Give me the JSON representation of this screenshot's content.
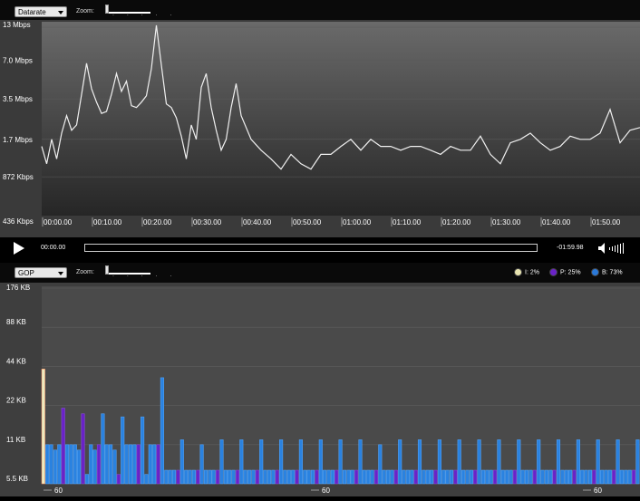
{
  "top": {
    "dropdown_value": "Datarate",
    "zoom_label": "Zoom:",
    "y_ticks": [
      "13 Mbps",
      "7.0 Mbps",
      "3.5 Mbps",
      "1.7 Mbps",
      "872 Kbps",
      "436 Kbps"
    ],
    "x_ticks": [
      "00:00.00",
      "00:10.00",
      "00:20.00",
      "00:30.00",
      "00:40.00",
      "00:50.00",
      "01:00.00",
      "01:10.00",
      "01:20.00",
      "01:30.00",
      "01:40.00",
      "01:50.00"
    ]
  },
  "player": {
    "current_time": "00:00.00",
    "remaining_time": "-01:59.98",
    "play_icon": "play-icon",
    "volume_icon": "speaker-icon"
  },
  "bottom": {
    "dropdown_value": "GOP",
    "zoom_label": "Zoom:",
    "legend": [
      {
        "label": "I: 2%",
        "color": "#e8e4b0"
      },
      {
        "label": "P: 25%",
        "color": "#6a22c8"
      },
      {
        "label": "B: 73%",
        "color": "#2a78d8"
      }
    ],
    "y_ticks": [
      "176 KB",
      "88 KB",
      "44 KB",
      "22 KB",
      "11 KB",
      "5.5 KB"
    ],
    "gop_labels": [
      "60",
      "60",
      "60"
    ]
  },
  "chart_data": [
    {
      "type": "line",
      "ylabel": "",
      "yscale": "log",
      "ylim": [
        436,
        13000
      ],
      "xlim": [
        0,
        120
      ],
      "y_ticks": [
        "436 Kbps",
        "872 Kbps",
        "1.7 Mbps",
        "3.5 Mbps",
        "7.0 Mbps",
        "13 Mbps"
      ],
      "series": [
        {
          "x": [
            0,
            1,
            2,
            3,
            4,
            5,
            6,
            7,
            8,
            9,
            10,
            11,
            12,
            13,
            14,
            15,
            16,
            17,
            18,
            19,
            20,
            21,
            22,
            23,
            24,
            25,
            26,
            27,
            28,
            29,
            30,
            31,
            32,
            33,
            34,
            35,
            36,
            37,
            38,
            39,
            40,
            42,
            44,
            46,
            48,
            50,
            52,
            54,
            56,
            58,
            60,
            62,
            64,
            66,
            68,
            70,
            72,
            74,
            76,
            78,
            80,
            82,
            84,
            86,
            88,
            90,
            92,
            94,
            96,
            98,
            100,
            102,
            104,
            106,
            108,
            110,
            112,
            114,
            116,
            118,
            120
          ],
          "y": [
            1500,
            1100,
            1700,
            1200,
            1900,
            2600,
            2000,
            2200,
            3800,
            6600,
            4200,
            3300,
            2700,
            2800,
            3800,
            5500,
            4000,
            4800,
            3100,
            3000,
            3300,
            3700,
            6000,
            13000,
            6400,
            3200,
            3000,
            2500,
            1800,
            1200,
            2200,
            1700,
            4300,
            5500,
            3000,
            2000,
            1400,
            1700,
            3000,
            4600,
            2600,
            1700,
            1400,
            1200,
            1000,
            1300,
            1100,
            1000,
            1300,
            1300,
            1500,
            1700,
            1400,
            1700,
            1500,
            1500,
            1400,
            1500,
            1500,
            1400,
            1300,
            1500,
            1400,
            1400,
            1800,
            1300,
            1100,
            1600,
            1700,
            1900,
            1600,
            1400,
            1500,
            1800,
            1700,
            1700,
            1900,
            2900,
            1600,
            2000,
            2100
          ]
        }
      ]
    },
    {
      "type": "bar",
      "ylabel": "",
      "yscale": "log",
      "ylim": [
        5.5,
        176
      ],
      "y_ticks": [
        "5.5 KB",
        "11 KB",
        "22 KB",
        "44 KB",
        "88 KB",
        "176 KB"
      ],
      "series": [
        {
          "name": "I: 2%",
          "frame_type": "I"
        },
        {
          "name": "P: 25%",
          "frame_type": "P"
        },
        {
          "name": "B: 73%",
          "frame_type": "B"
        }
      ],
      "frames_type": "IBBBBPBBBBPBBBPBBBBPBBBBPBBBBPBBBBPBBBBPBBBBPBBBBPBBBBPBBBBPBBBBPBBBBPBBBBPBBBBPBBBBPBBBBPBBBBPBBBBPBBBBPBBBBPBBBBPBBBBPBBBBPBBBBPBBBBPBBBBPBBBBPBBBBPBBBBPBBBBPBBBBPBBBBPBBBBPBBBBPBBBBPBBBBPBBBBPBBBBPB",
      "values": [
        42,
        11,
        11,
        10,
        11,
        21,
        11,
        11,
        11,
        10,
        19,
        6.5,
        11,
        10,
        11,
        19,
        11,
        11,
        10,
        6.5,
        18,
        11,
        11,
        11,
        11,
        18,
        6.5,
        11,
        11,
        11,
        36,
        7,
        7,
        7,
        7,
        12,
        7,
        7,
        7,
        7,
        11,
        7,
        7,
        7,
        7,
        12,
        7,
        7,
        7,
        7,
        12,
        7,
        7,
        7,
        7,
        12,
        7,
        7,
        7,
        7,
        12,
        7,
        7,
        7,
        7,
        12,
        7,
        7,
        7,
        7,
        12,
        7,
        7,
        7,
        7,
        12,
        7,
        7,
        7,
        7,
        12,
        7,
        7,
        7,
        7,
        11,
        7,
        7,
        7,
        7,
        12,
        7,
        7,
        7,
        7,
        12,
        7,
        7,
        7,
        7,
        12,
        7,
        7,
        7,
        7,
        12,
        7,
        7,
        7,
        7,
        12,
        7,
        7,
        7,
        7,
        12,
        7,
        7,
        7,
        7,
        12,
        7,
        7,
        7,
        7,
        12,
        7,
        7,
        7,
        7,
        12,
        7,
        7,
        7,
        7,
        12,
        7,
        7,
        7,
        7,
        12,
        7,
        7,
        7,
        7,
        12,
        7,
        7,
        7,
        7,
        12
      ]
    }
  ]
}
